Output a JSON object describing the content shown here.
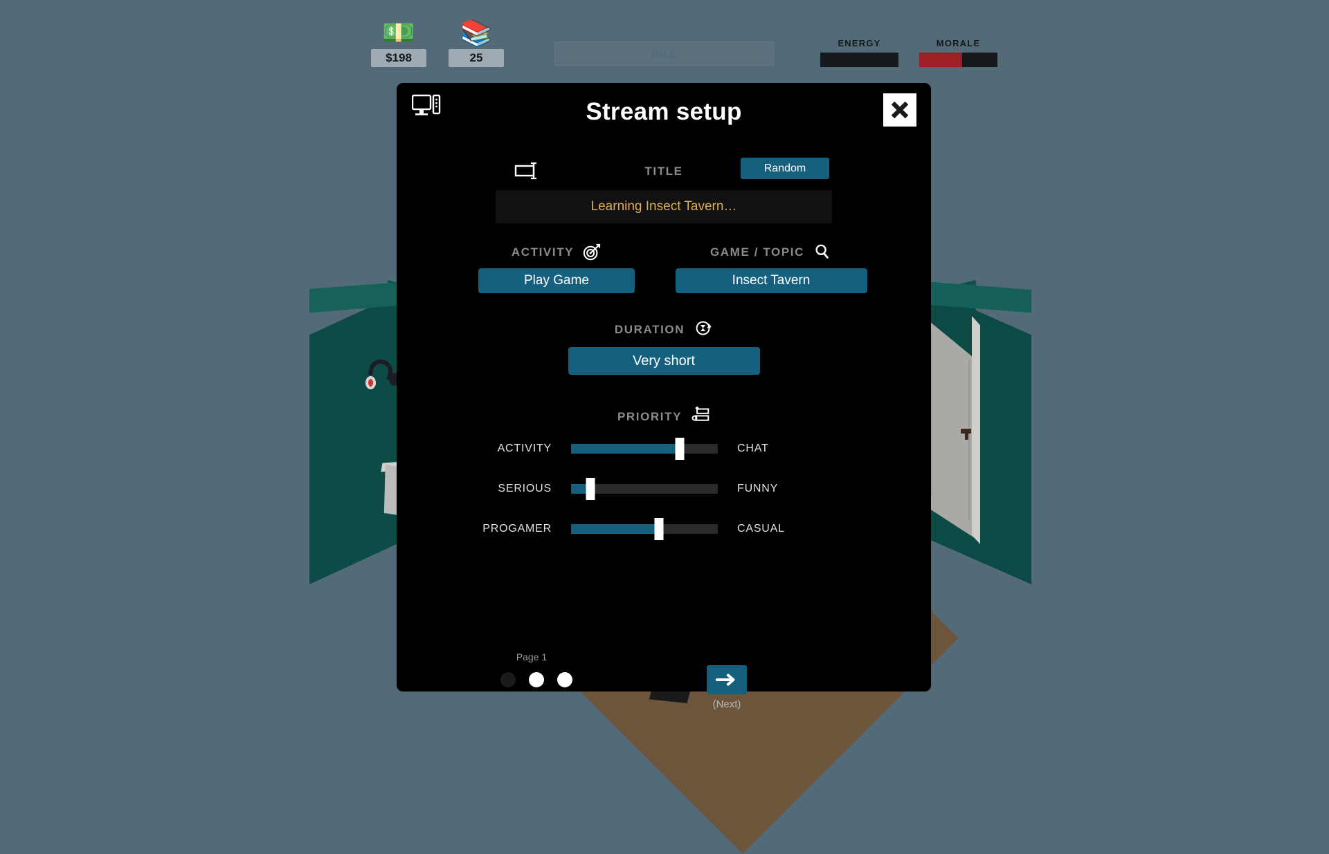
{
  "hud": {
    "money": {
      "icon": "money-icon",
      "glyph": "💵",
      "value": "$198"
    },
    "knowledge": {
      "icon": "books-icon",
      "glyph": "📚",
      "value": "25"
    },
    "status": {
      "text": "IDLE"
    },
    "meters": [
      {
        "name": "energy",
        "label": "ENERGY",
        "percent": 0,
        "color": "#1f2a2e"
      },
      {
        "name": "morale",
        "label": "MORALE",
        "percent": 55,
        "color": "#9d2026"
      }
    ]
  },
  "modal": {
    "icon": "desktop-pc-icon",
    "title": "Stream setup",
    "close_label": "close-icon",
    "title_section": {
      "icon": "text-field-icon",
      "label": "TITLE",
      "random_button": "Random",
      "value": "Learning Insect Tavern…"
    },
    "activity_section": {
      "icon": "target-icon",
      "label": "ACTIVITY",
      "value": "Play Game"
    },
    "game_section": {
      "icon": "magnifier-icon",
      "label": "GAME / TOPIC",
      "value": "Insect Tavern"
    },
    "duration_section": {
      "icon": "hourglass-refresh-icon",
      "label": "DURATION",
      "value": "Very short"
    },
    "priority_section": {
      "icon": "sliders-icon",
      "label": "PRIORITY",
      "sliders": [
        {
          "name": "activity-chat",
          "left_label": "ACTIVITY",
          "right_label": "CHAT",
          "percent": 74
        },
        {
          "name": "serious-funny",
          "left_label": "SERIOUS",
          "right_label": "FUNNY",
          "percent": 13
        },
        {
          "name": "progamer-casual",
          "left_label": "PROGAMER",
          "right_label": "CASUAL",
          "percent": 60
        }
      ]
    },
    "footer": {
      "page_label": "Page 1",
      "dots": [
        {
          "active": true
        },
        {
          "active": false
        },
        {
          "active": false
        }
      ],
      "next_icon": "arrow-right-icon",
      "next_label": "(Next)"
    }
  },
  "theme": {
    "accent": "#15607f",
    "background": "#536b78",
    "modal_bg": "#000000",
    "title_text": "#e0ad4a",
    "wall": "#0e534d",
    "floor": "#6d553c"
  }
}
